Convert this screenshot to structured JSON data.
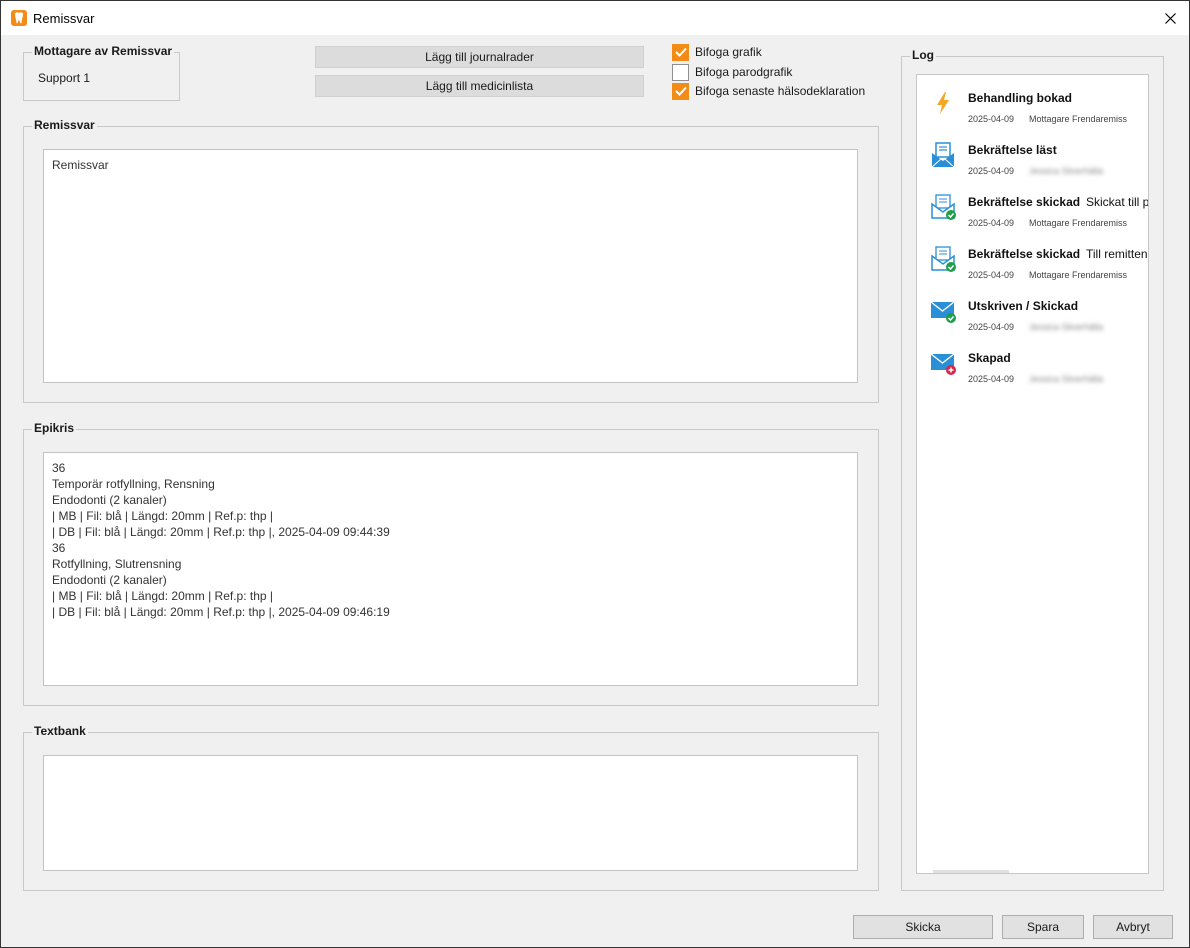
{
  "window": {
    "title": "Remissvar"
  },
  "recipient": {
    "label": "Mottagare av Remissvar",
    "value": "Support 1"
  },
  "buttons": {
    "add_journal": "Lägg till journalrader",
    "add_medlist": "Lägg till medicinlista",
    "send": "Skicka",
    "save": "Spara",
    "cancel": "Avbryt"
  },
  "checkboxes": [
    {
      "label": "Bifoga grafik",
      "checked": true
    },
    {
      "label": "Bifoga parodgrafik",
      "checked": false
    },
    {
      "label": "Bifoga senaste hälsodeklaration",
      "checked": true
    }
  ],
  "remissvar": {
    "label": "Remissvar",
    "text": "Remissvar"
  },
  "epikris": {
    "label": "Epikris",
    "text": "36\nTemporär rotfyllning, Rensning\nEndodonti (2 kanaler)\n| MB | Fil: blå | Längd: 20mm | Ref.p: thp |\n| DB | Fil: blå | Längd: 20mm | Ref.p: thp |, 2025-04-09 09:44:39\n36\nRotfyllning, Slutrensning\nEndodonti (2 kanaler)\n| MB | Fil: blå | Längd: 20mm | Ref.p: thp |\n| DB | Fil: blå | Längd: 20mm | Ref.p: thp |, 2025-04-09 09:46:19"
  },
  "textbank": {
    "label": "Textbank",
    "text": ""
  },
  "log": {
    "label": "Log",
    "items": [
      {
        "icon": "lightning-icon",
        "title": "Behandling bokad",
        "extra": "",
        "date": "2025-04-09",
        "user": "Mottagare Frendaremiss",
        "blurred": false
      },
      {
        "icon": "envelope-read-icon",
        "title": "Bekräftelse läst",
        "extra": "",
        "date": "2025-04-09",
        "user": "Jessica Silverhälla",
        "blurred": true
      },
      {
        "icon": "envelope-check-icon",
        "title": "Bekräftelse skickad",
        "extra": "Skickat till p",
        "date": "2025-04-09",
        "user": "Mottagare Frendaremiss",
        "blurred": false
      },
      {
        "icon": "envelope-check-icon",
        "title": "Bekräftelse skickad",
        "extra": "Till remitten",
        "date": "2025-04-09",
        "user": "Mottagare Frendaremiss",
        "blurred": false
      },
      {
        "icon": "mail-sent-icon",
        "title": "Utskriven / Skickad",
        "extra": "",
        "date": "2025-04-09",
        "user": "Jessica Silverhälla",
        "blurred": true
      },
      {
        "icon": "mail-new-icon",
        "title": "Skapad",
        "extra": "",
        "date": "2025-04-09",
        "user": "Jessica Silverhälla",
        "blurred": true
      }
    ]
  },
  "colors": {
    "accent": "#f28c16",
    "icon_blue": "#2a8fd6",
    "check_green": "#1f9d4b",
    "add_red": "#d9254a"
  }
}
